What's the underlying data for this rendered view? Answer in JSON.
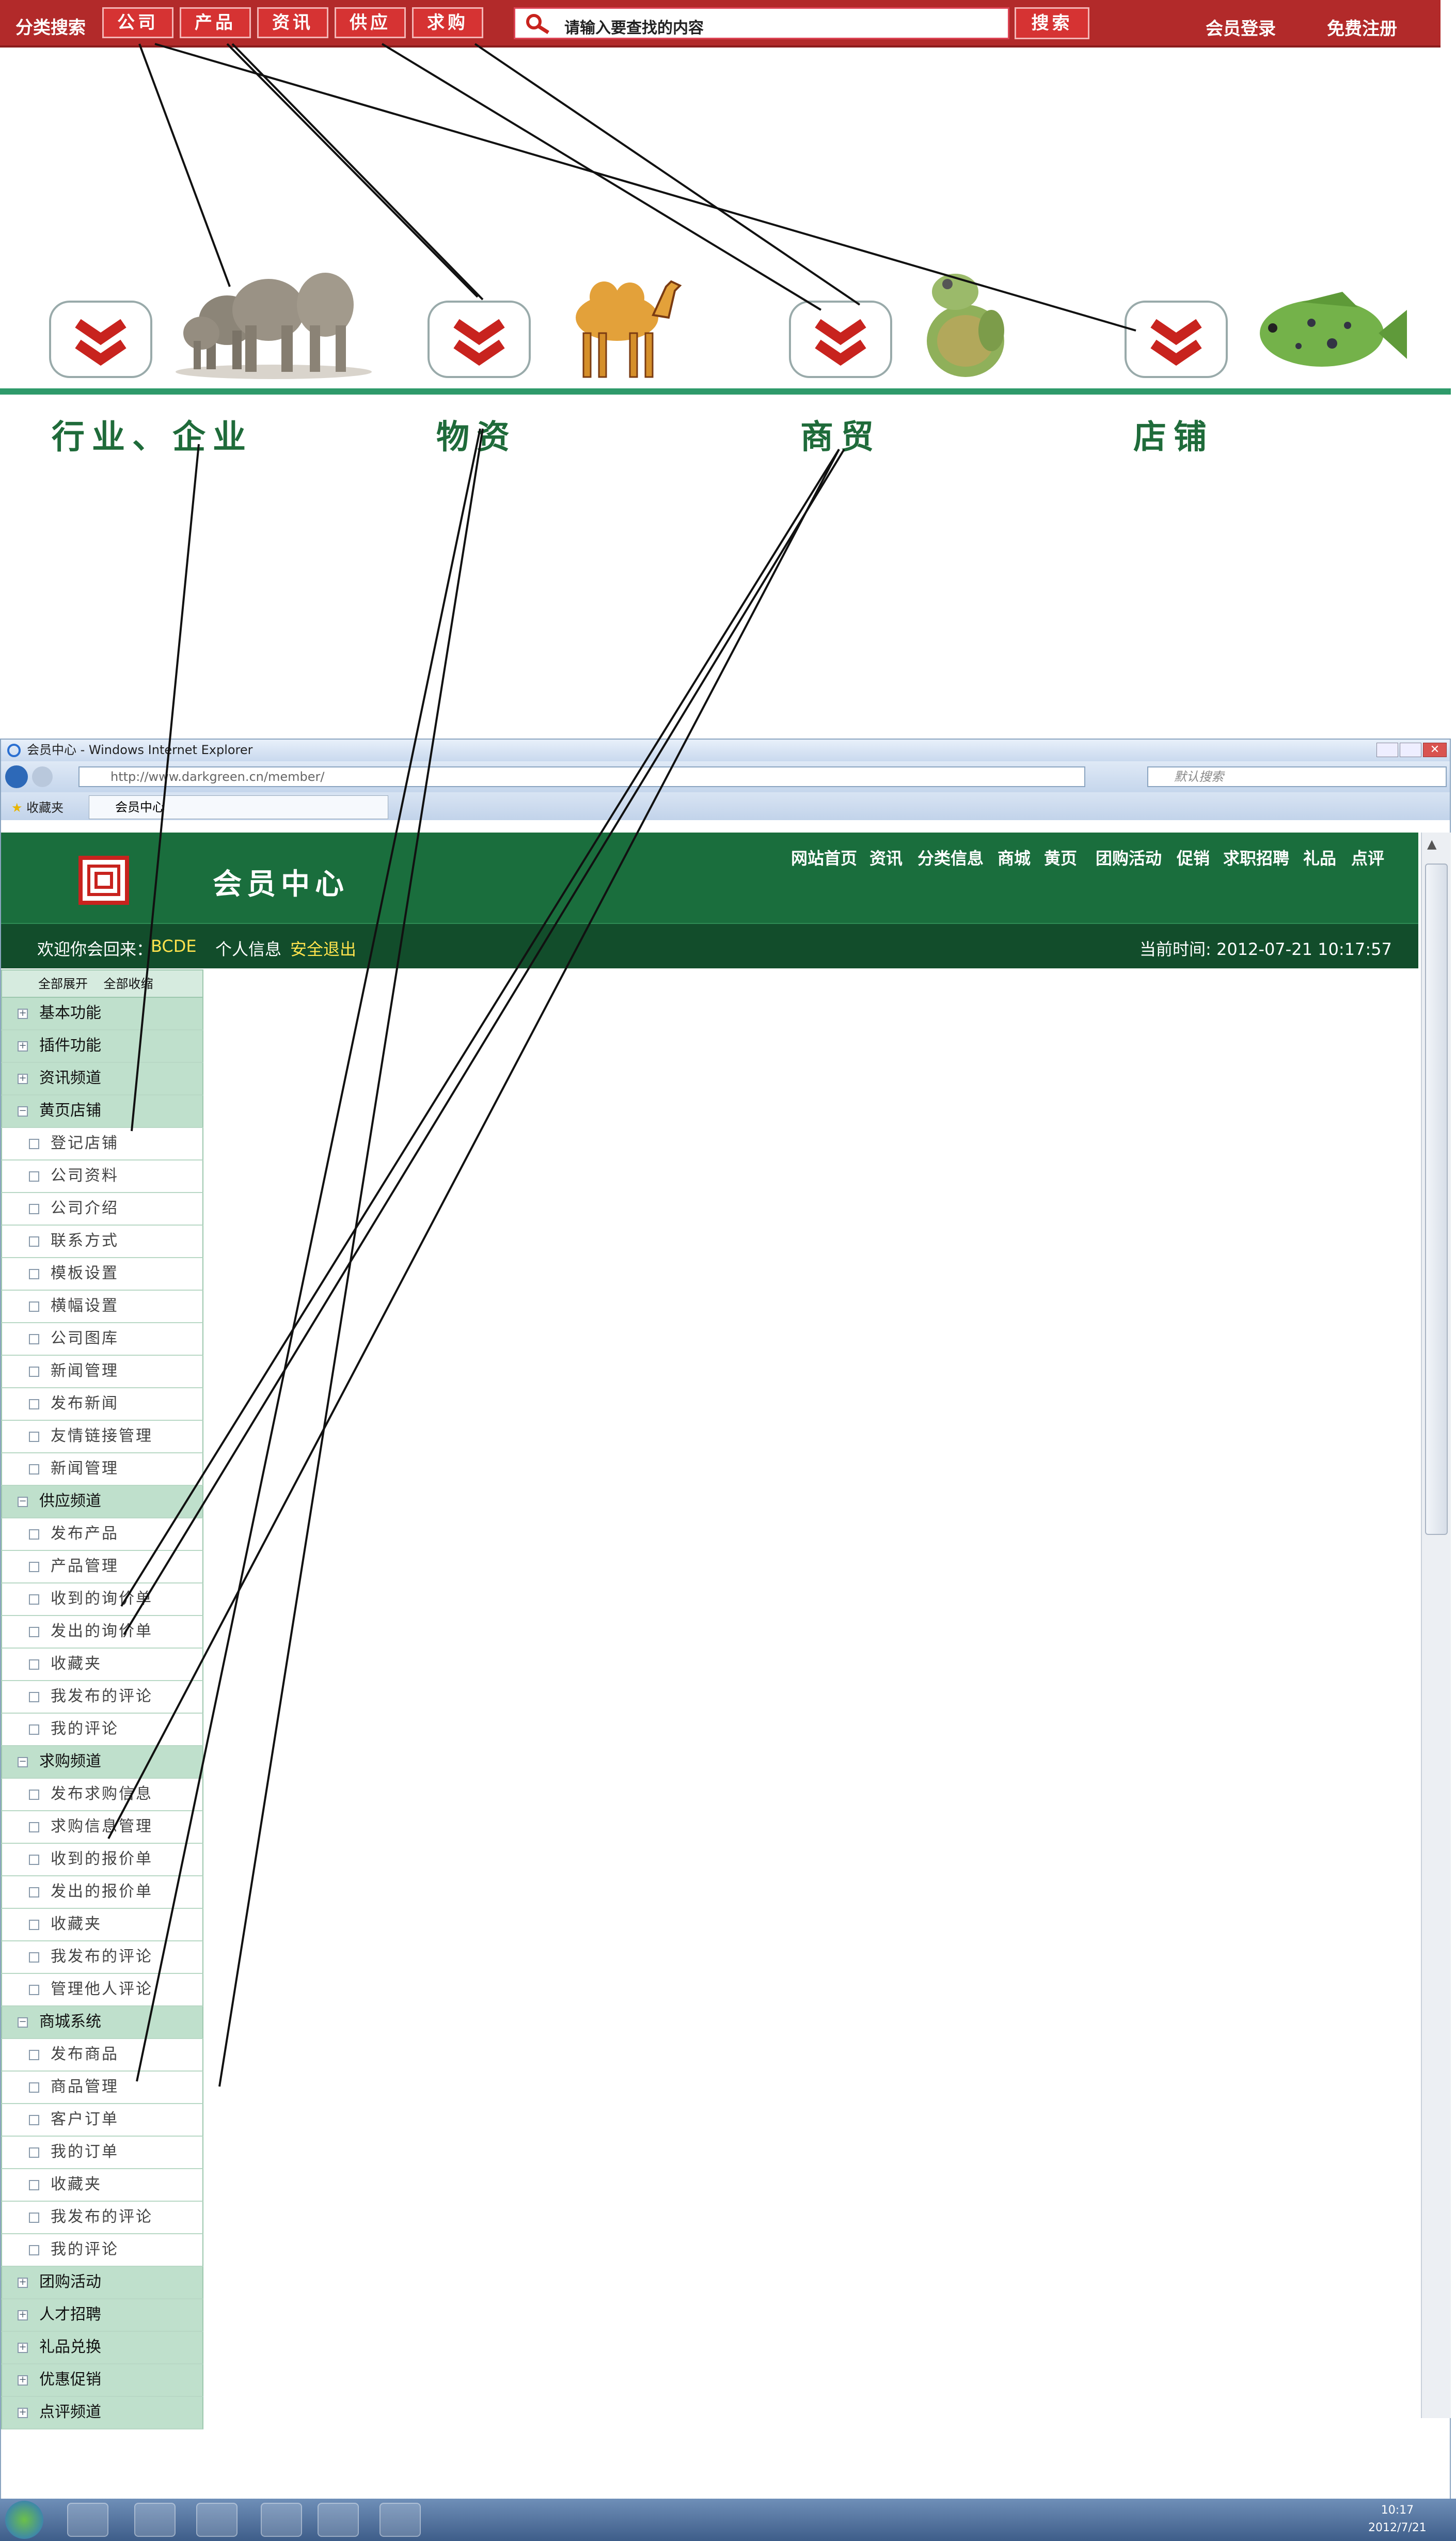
{
  "top_bar": {
    "category_search_label": "分类搜索",
    "categories": [
      "公司",
      "产品",
      "资讯",
      "供应",
      "求购"
    ],
    "search_placeholder": "请输入要查找的内容",
    "search_button": "搜索",
    "login": "会员登录",
    "register": "免费注册"
  },
  "category_labels": [
    "行业、企业",
    "物资",
    "商贸",
    "店铺"
  ],
  "colors": {
    "top_bar": "#b22a2a",
    "header_green": "#1a6e3d",
    "accent_chevron": "#c8231e",
    "sidebar_category": "#bfe0cc"
  },
  "browser": {
    "title": "会员中心 - Windows Internet Explorer",
    "url": "http://www.darkgreen.cn/member/",
    "search_placeholder": "默认搜索",
    "favorites": "收藏夹",
    "tab_title": "会员中心"
  },
  "member_header": {
    "title": "会员中心",
    "nav": [
      "网站首页",
      "资讯",
      "分类信息",
      "商城",
      "黄页",
      "团购活动",
      "促销",
      "求职招聘",
      "礼品",
      "点评"
    ],
    "welcome_prefix": "欢迎你会回来：",
    "username": "BCDE",
    "profile_link": "个人信息",
    "logout_link": "安全退出",
    "current_time": "当前时间: 2012-07-21   10:17:57"
  },
  "sidebar": {
    "expand_all": "全部展开",
    "collapse_all": "全部收缩",
    "rows": [
      {
        "type": "cat",
        "label": "基本功能",
        "box": "+"
      },
      {
        "type": "cat",
        "label": "插件功能",
        "box": "+"
      },
      {
        "type": "cat",
        "label": "资讯频道",
        "box": "+"
      },
      {
        "type": "cat",
        "label": "黄页店铺",
        "box": "−"
      },
      {
        "type": "sub",
        "label": "登记店铺"
      },
      {
        "type": "sub",
        "label": "公司资料"
      },
      {
        "type": "sub",
        "label": "公司介绍"
      },
      {
        "type": "sub",
        "label": "联系方式"
      },
      {
        "type": "sub",
        "label": "模板设置"
      },
      {
        "type": "sub",
        "label": "横幅设置"
      },
      {
        "type": "sub",
        "label": "公司图库"
      },
      {
        "type": "sub",
        "label": "新闻管理"
      },
      {
        "type": "sub",
        "label": "发布新闻"
      },
      {
        "type": "sub",
        "label": "友情链接管理"
      },
      {
        "type": "sub",
        "label": "新闻管理"
      },
      {
        "type": "cat",
        "label": "供应频道",
        "box": "−"
      },
      {
        "type": "sub",
        "label": "发布产品"
      },
      {
        "type": "sub",
        "label": "产品管理"
      },
      {
        "type": "sub",
        "label": "收到的询价单"
      },
      {
        "type": "sub",
        "label": "发出的询价单"
      },
      {
        "type": "sub",
        "label": "收藏夹"
      },
      {
        "type": "sub",
        "label": "我发布的评论"
      },
      {
        "type": "sub",
        "label": "我的评论"
      },
      {
        "type": "cat",
        "label": "求购频道",
        "box": "−"
      },
      {
        "type": "sub",
        "label": "发布求购信息"
      },
      {
        "type": "sub",
        "label": "求购信息管理"
      },
      {
        "type": "sub",
        "label": "收到的报价单"
      },
      {
        "type": "sub",
        "label": "发出的报价单"
      },
      {
        "type": "sub",
        "label": "收藏夹"
      },
      {
        "type": "sub",
        "label": "我发布的评论"
      },
      {
        "type": "sub",
        "label": "管理他人评论"
      },
      {
        "type": "cat",
        "label": "商城系统",
        "box": "−"
      },
      {
        "type": "sub",
        "label": "发布商品"
      },
      {
        "type": "sub",
        "label": "商品管理"
      },
      {
        "type": "sub",
        "label": "客户订单"
      },
      {
        "type": "sub",
        "label": "我的订单"
      },
      {
        "type": "sub",
        "label": "收藏夹"
      },
      {
        "type": "sub",
        "label": "我发布的评论"
      },
      {
        "type": "sub",
        "label": "我的评论"
      },
      {
        "type": "cat",
        "label": "团购活动",
        "box": "+"
      },
      {
        "type": "cat",
        "label": "人才招聘",
        "box": "+"
      },
      {
        "type": "cat",
        "label": "礼品兑换",
        "box": "+"
      },
      {
        "type": "cat",
        "label": "优惠促销",
        "box": "+"
      },
      {
        "type": "cat",
        "label": "点评频道",
        "box": "+"
      }
    ]
  },
  "taskbar": {
    "time": "10:17",
    "date": "2012/7/21"
  }
}
